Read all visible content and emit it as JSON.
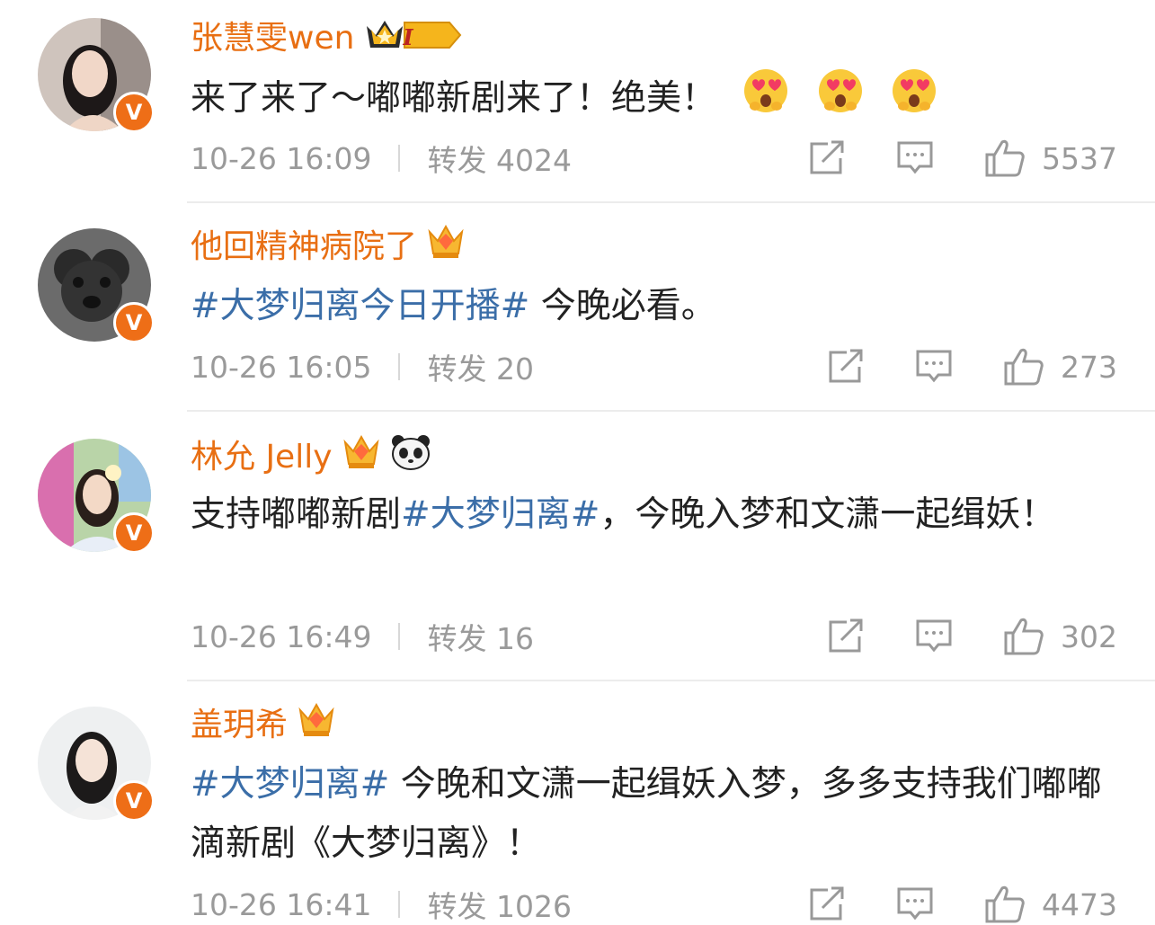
{
  "comments": [
    {
      "name": "张慧雯wen",
      "badge_level": "I",
      "text_plain": "来了来了～嘟嘟新剧来了！绝美！",
      "emoji_name": "heart-eyes-emoji",
      "timestamp": "10-26 16:09",
      "repost": "转发 4024",
      "likes": "5537"
    },
    {
      "name": "他回精神病院了",
      "hashtag": "#大梦归离今日开播#",
      "text_after": " 今晚必看。",
      "timestamp": "10-26 16:05",
      "repost": "转发 20",
      "likes": "273"
    },
    {
      "name": "林允 Jelly",
      "text_before": "支持嘟嘟新剧",
      "hashtag": "#大梦归离#",
      "text_after": "，今晚入梦和文潇一起缉妖！",
      "timestamp": "10-26 16:49",
      "repost": "转发 16",
      "likes": "302"
    },
    {
      "name": "盖玥希",
      "hashtag": "#大梦归离#",
      "text_after": " 今晚和文潇一起缉妖入梦，多多支持我们嘟嘟滴新剧《大梦归离》！",
      "timestamp": "10-26 16:41",
      "repost": "转发 1026",
      "likes": "4473"
    }
  ],
  "colors": {
    "name": "#e86f13",
    "hashtag": "#3b6ea8",
    "meta": "#9a9a9a",
    "verified_badge": "#ee6e17"
  }
}
